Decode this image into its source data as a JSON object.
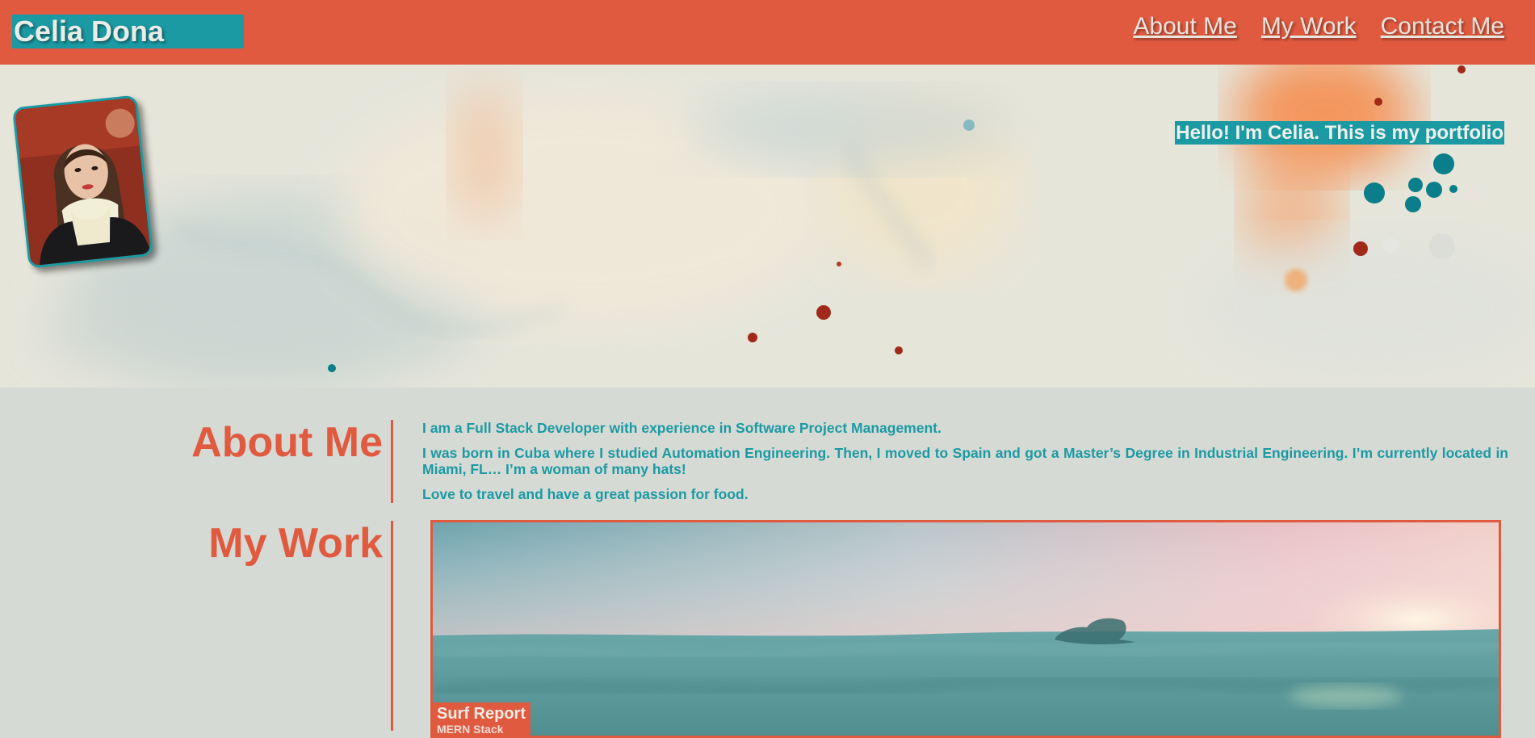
{
  "header": {
    "brand": "Celia Dona",
    "nav": [
      {
        "label": "About Me"
      },
      {
        "label": "My Work"
      },
      {
        "label": "Contact Me"
      }
    ]
  },
  "hero": {
    "greeting": "Hello! I'm Celia. This is my portfolio"
  },
  "about": {
    "title": "About Me",
    "paragraphs": [
      "I am a Full Stack Developer with experience in Software Project Management.",
      "I was born in Cuba where I studied Automation Engineering. Then, I moved to Spain and got a Master’s Degree in Industrial Engineering. I’m currently located in Miami, FL… I’m a woman of many hats!",
      "Love to travel and have a great passion for food."
    ]
  },
  "work": {
    "title": "My Work",
    "projects": [
      {
        "title": "Surf Report",
        "subtitle": "MERN Stack"
      }
    ]
  },
  "colors": {
    "accent": "#e05a3f",
    "teal": "#1b9aa3",
    "background": "#d6dad5"
  }
}
